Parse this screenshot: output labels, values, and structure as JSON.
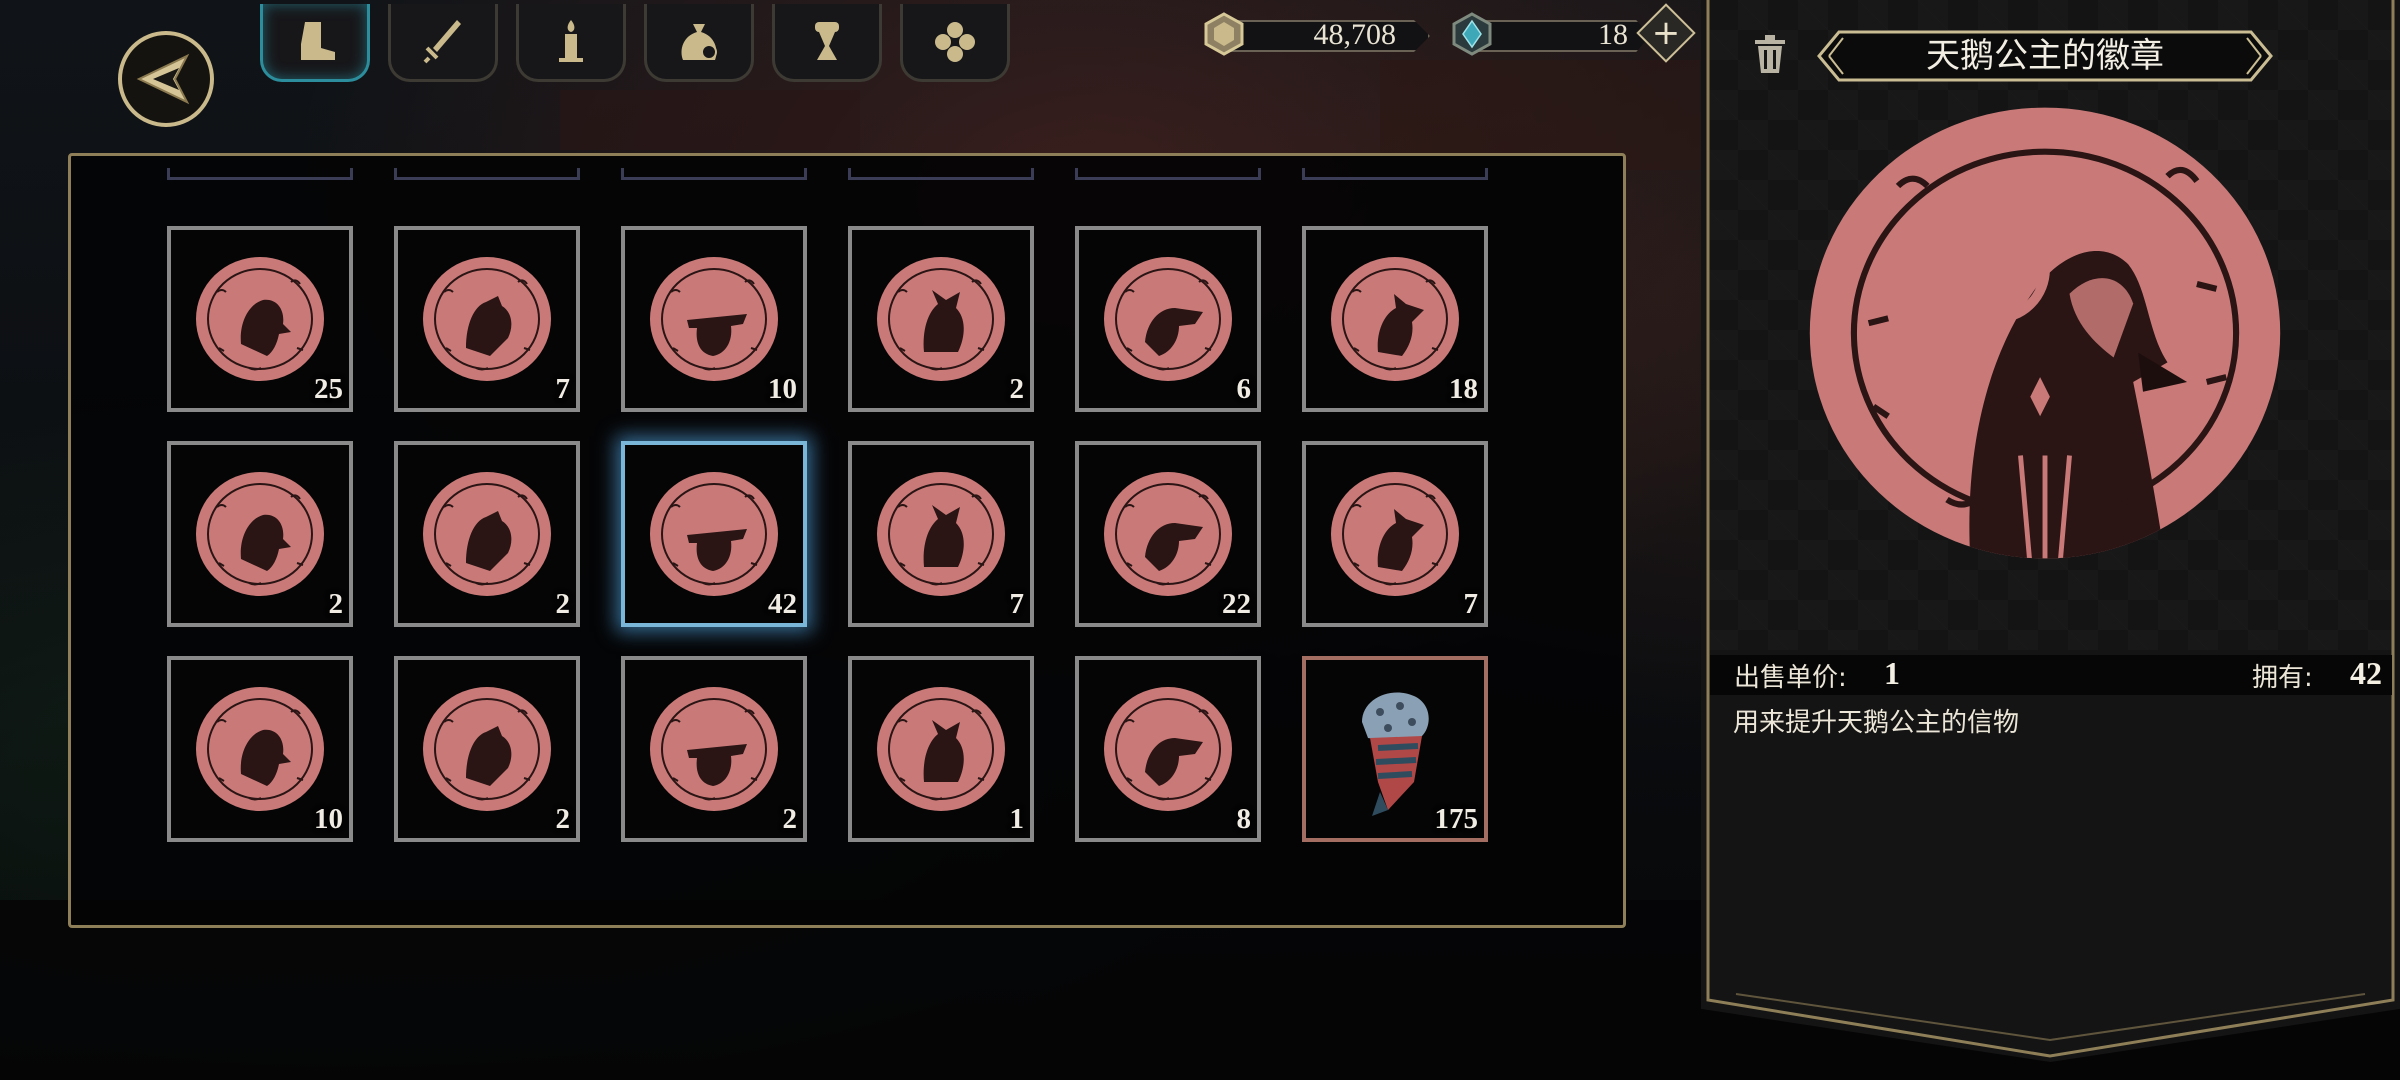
{
  "tabs": [
    {
      "name": "boot-icon",
      "active": true
    },
    {
      "name": "sword-icon",
      "active": false
    },
    {
      "name": "candle-icon",
      "active": false
    },
    {
      "name": "money-bag-icon",
      "active": false
    },
    {
      "name": "scroll-icon",
      "active": false
    },
    {
      "name": "clover-icon",
      "active": false
    }
  ],
  "resources": {
    "gold": {
      "value": "48,708",
      "icon": "gold-coin-icon"
    },
    "gems": {
      "value": "18",
      "icon": "gem-icon"
    }
  },
  "colors": {
    "coin": "#c97a78",
    "coin_dark": "#2a1414",
    "accent": "#c9b98b",
    "selected": "#7ab6d8",
    "gem": "#3fa8b8"
  },
  "inventory": [
    {
      "count": "25",
      "icon": "badge-coin-icon"
    },
    {
      "count": "7",
      "icon": "badge-coin-icon"
    },
    {
      "count": "10",
      "icon": "badge-coin-icon"
    },
    {
      "count": "2",
      "icon": "badge-coin-icon"
    },
    {
      "count": "6",
      "icon": "badge-coin-icon"
    },
    {
      "count": "18",
      "icon": "badge-coin-icon"
    },
    {
      "count": "2",
      "icon": "badge-coin-icon"
    },
    {
      "count": "2",
      "icon": "badge-coin-icon"
    },
    {
      "count": "42",
      "icon": "badge-coin-icon",
      "selected": true
    },
    {
      "count": "7",
      "icon": "badge-coin-icon"
    },
    {
      "count": "22",
      "icon": "badge-coin-icon"
    },
    {
      "count": "7",
      "icon": "badge-coin-icon"
    },
    {
      "count": "10",
      "icon": "badge-coin-icon"
    },
    {
      "count": "2",
      "icon": "badge-coin-icon"
    },
    {
      "count": "2",
      "icon": "badge-coin-icon"
    },
    {
      "count": "1",
      "icon": "badge-coin-icon"
    },
    {
      "count": "8",
      "icon": "badge-coin-icon"
    },
    {
      "count": "175",
      "icon": "bandana-head-icon"
    }
  ],
  "detail": {
    "title": "天鹅公主的徽章",
    "sell_label": "出售单价:",
    "sell_price": "1",
    "owned_label": "拥有:",
    "owned": "42",
    "description": "用来提升天鹅公主的信物"
  }
}
